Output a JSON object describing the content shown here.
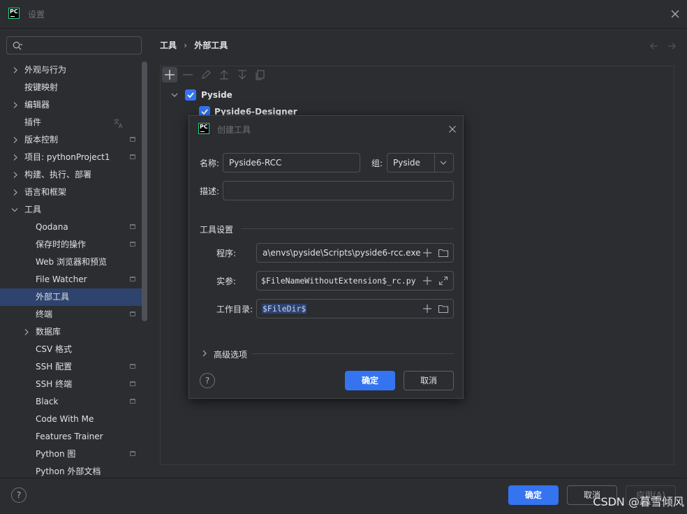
{
  "window": {
    "title": "设置"
  },
  "sidebar": {
    "search_placeholder": "",
    "items": [
      {
        "label": "外观与行为"
      },
      {
        "label": "按键映射"
      },
      {
        "label": "编辑器"
      },
      {
        "label": "插件"
      },
      {
        "label": "版本控制"
      },
      {
        "label": "项目: pythonProject1"
      },
      {
        "label": "构建、执行、部署"
      },
      {
        "label": "语言和框架"
      },
      {
        "label": "工具"
      },
      {
        "label": "Qodana"
      },
      {
        "label": "保存时的操作"
      },
      {
        "label": "Web 浏览器和预览"
      },
      {
        "label": "File Watcher"
      },
      {
        "label": "外部工具"
      },
      {
        "label": "终端"
      },
      {
        "label": "数据库"
      },
      {
        "label": "CSV 格式"
      },
      {
        "label": "SSH 配置"
      },
      {
        "label": "SSH 终端"
      },
      {
        "label": "Black"
      },
      {
        "label": "Code With Me"
      },
      {
        "label": "Features Trainer"
      },
      {
        "label": "Python 图"
      },
      {
        "label": "Python 外部文档"
      }
    ],
    "selected": "外部工具"
  },
  "breadcrumb": {
    "parent": "工具",
    "current": "外部工具"
  },
  "tools_tree": {
    "group": {
      "label": "Pyside",
      "checked": true
    },
    "items": [
      {
        "label": "Pyside6-Designer",
        "checked": true
      }
    ]
  },
  "dialog": {
    "title": "创建工具",
    "name_label": "名称:",
    "name_value": "Pyside6-RCC",
    "group_label": "组:",
    "group_value": "Pyside",
    "desc_label": "描述:",
    "desc_value": "",
    "section_title": "工具设置",
    "program_label": "程序:",
    "program_value": "a\\envs\\pyside\\Scripts\\pyside6-rcc.exe",
    "args_label": "实参:",
    "args_value": "$FileNameWithoutExtension$_rc.py",
    "workdir_label": "工作目录:",
    "workdir_value": "$FileDir$",
    "advanced_label": "高级选项",
    "help_label": "?",
    "ok_label": "确定",
    "cancel_label": "取消"
  },
  "footer": {
    "help_label": "?",
    "ok_label": "确定",
    "cancel_label": "取消",
    "apply_label": "应用(A)"
  },
  "watermark": "CSDN @暮雪倾风",
  "colors": {
    "accent": "#3574f0",
    "selection": "#2e436e",
    "background": "#2b2d30"
  }
}
